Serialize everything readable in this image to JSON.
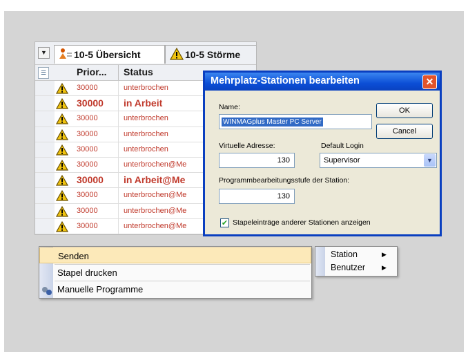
{
  "list": {
    "tabs": [
      {
        "label": "10-5 Übersicht",
        "active": true,
        "icon": "people-icon"
      },
      {
        "label": "10-5 Störme",
        "active": false,
        "icon": "warning-icon"
      }
    ],
    "columns": {
      "priority": "Prior...",
      "status": "Status"
    },
    "rows": [
      {
        "priority": "30000",
        "status": "unterbrochen",
        "bold": false
      },
      {
        "priority": "30000",
        "status": "in Arbeit",
        "bold": true
      },
      {
        "priority": "30000",
        "status": "unterbrochen",
        "bold": false
      },
      {
        "priority": "30000",
        "status": "unterbrochen",
        "bold": false
      },
      {
        "priority": "30000",
        "status": "unterbrochen",
        "bold": false
      },
      {
        "priority": "30000",
        "status": "unterbrochen@Me",
        "bold": false
      },
      {
        "priority": "30000",
        "status": "in Arbeit@Me",
        "bold": true
      },
      {
        "priority": "30000",
        "status": "unterbrochen@Me",
        "bold": false
      },
      {
        "priority": "30000",
        "status": "unterbrochen@Me",
        "bold": false
      },
      {
        "priority": "30000",
        "status": "unterbrochen@Me",
        "bold": false
      }
    ]
  },
  "dialog": {
    "title": "Mehrplatz-Stationen bearbeiten",
    "name_label": "Name:",
    "name_value": "WINMAGplus Master PC Server",
    "ok_label": "OK",
    "cancel_label": "Cancel",
    "address_label": "Virtuelle Adresse:",
    "address_value": "130",
    "login_label": "Default Login",
    "login_value": "Supervisor",
    "level_label": "Programmbearbeitungsstufe der Station:",
    "level_value": "130",
    "checkbox_label": "Stapeleinträge anderer Stationen anzeigen",
    "checkbox_checked": true
  },
  "context_menu": {
    "items": [
      {
        "label": "Senden",
        "highlighted": true
      },
      {
        "label": "Stapel drucken",
        "highlighted": false
      },
      {
        "label": "Manuelle Programme",
        "highlighted": false,
        "icon": "programs-icon"
      }
    ]
  },
  "submenu": {
    "items": [
      {
        "label": "Station"
      },
      {
        "label": "Benutzer"
      }
    ]
  },
  "colors": {
    "status_red": "#c0392b",
    "titlebar_blue": "#0b4ed6",
    "menu_highlight": "#fce9b9",
    "panel_gray": "#d5d5d5"
  }
}
